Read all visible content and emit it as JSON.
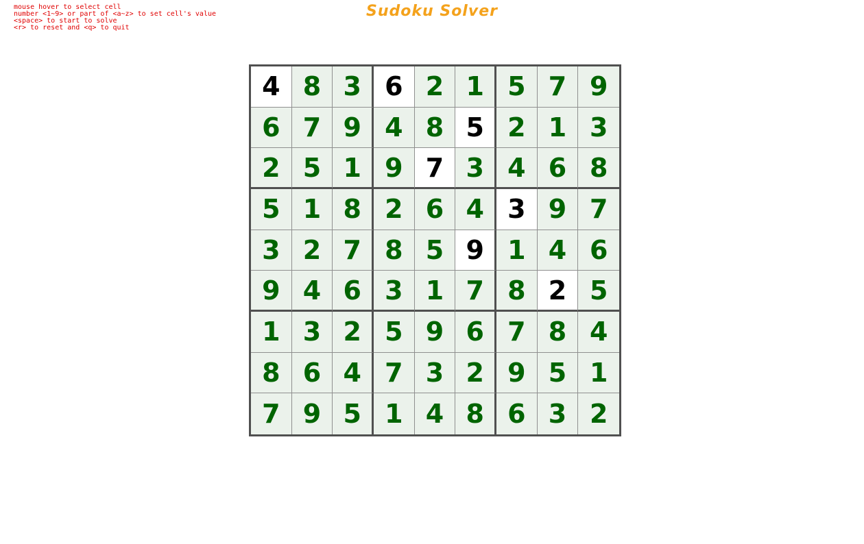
{
  "app": {
    "title": "Sudoku Solver",
    "title_color": "#f4a21c"
  },
  "help": [
    "mouse hover to select cell",
    "number <1~9> or part of <a~z> to set cell's value",
    "<space> to start to solve",
    "<r> to reset and <q> to quit"
  ],
  "help_color": "#e00000",
  "colors": {
    "given_digit": "#000000",
    "solved_digit": "#006400",
    "given_cell_bg": "#ffffff",
    "solved_cell_bg": "#ebf2eb",
    "grid_line": "#505050"
  },
  "board": {
    "rows": [
      [
        "4",
        "8",
        "3",
        "6",
        "2",
        "1",
        "5",
        "7",
        "9"
      ],
      [
        "6",
        "7",
        "9",
        "4",
        "8",
        "5",
        "2",
        "1",
        "3"
      ],
      [
        "2",
        "5",
        "1",
        "9",
        "7",
        "3",
        "4",
        "6",
        "8"
      ],
      [
        "5",
        "1",
        "8",
        "2",
        "6",
        "4",
        "3",
        "9",
        "7"
      ],
      [
        "3",
        "2",
        "7",
        "8",
        "5",
        "9",
        "1",
        "4",
        "6"
      ],
      [
        "9",
        "4",
        "6",
        "3",
        "1",
        "7",
        "8",
        "2",
        "5"
      ],
      [
        "1",
        "3",
        "2",
        "5",
        "9",
        "6",
        "7",
        "8",
        "4"
      ],
      [
        "8",
        "6",
        "4",
        "7",
        "3",
        "2",
        "9",
        "5",
        "1"
      ],
      [
        "7",
        "9",
        "5",
        "1",
        "4",
        "8",
        "6",
        "3",
        "2"
      ]
    ],
    "given": [
      [
        true,
        false,
        false,
        true,
        false,
        false,
        false,
        false,
        false
      ],
      [
        false,
        false,
        false,
        false,
        false,
        true,
        false,
        false,
        false
      ],
      [
        false,
        false,
        false,
        false,
        true,
        false,
        false,
        false,
        false
      ],
      [
        false,
        false,
        false,
        false,
        false,
        false,
        true,
        false,
        false
      ],
      [
        false,
        false,
        false,
        false,
        false,
        true,
        false,
        false,
        false
      ],
      [
        false,
        false,
        false,
        false,
        false,
        false,
        false,
        true,
        false
      ],
      [
        false,
        false,
        false,
        false,
        false,
        false,
        false,
        false,
        false
      ],
      [
        false,
        false,
        false,
        false,
        false,
        false,
        false,
        false,
        false
      ],
      [
        false,
        false,
        false,
        false,
        false,
        false,
        false,
        false,
        false
      ]
    ]
  }
}
